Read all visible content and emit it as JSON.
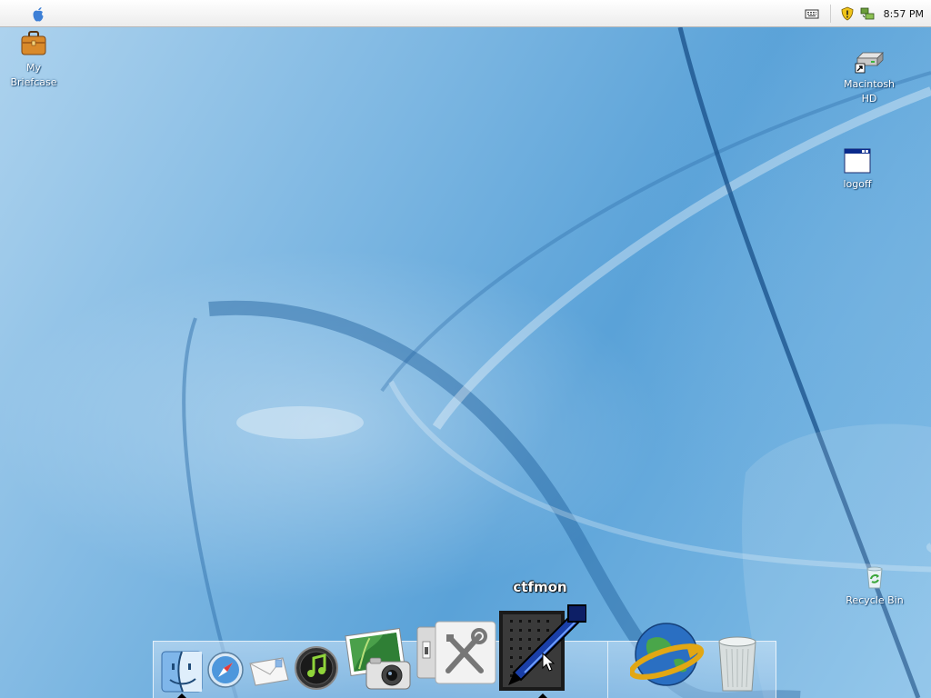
{
  "menubar": {
    "apple_menu": "apple-logo-icon",
    "tray_icons": [
      "keyboard-icon",
      "security-shield-icon",
      "network-icon"
    ],
    "clock": "8:57 PM"
  },
  "desktop_icons": {
    "my_briefcase": {
      "label": "My\nBriefcase",
      "icon": "briefcase-icon"
    },
    "macintosh_hd": {
      "label": "Macintosh\nHD",
      "icon": "hard-drive-icon"
    },
    "logoff": {
      "label": "logoff",
      "icon": "window-shortcut-icon"
    },
    "recycle_bin": {
      "label": "Recycle Bin",
      "icon": "recycle-bin-icon"
    }
  },
  "dock": {
    "tooltip": "ctfmon",
    "items": [
      "finder-icon",
      "safari-icon",
      "mail-icon",
      "itunes-icon",
      "iphoto-icon",
      "system-tools-icon",
      "ctfmon-pen-icon",
      "internet-globe-icon",
      "trash-icon"
    ]
  },
  "colors": {
    "wallpaper_light": "#aed3ee",
    "wallpaper_dark": "#1f5f9e",
    "menubar": "#ffffff",
    "label_text": "#ffffff"
  }
}
